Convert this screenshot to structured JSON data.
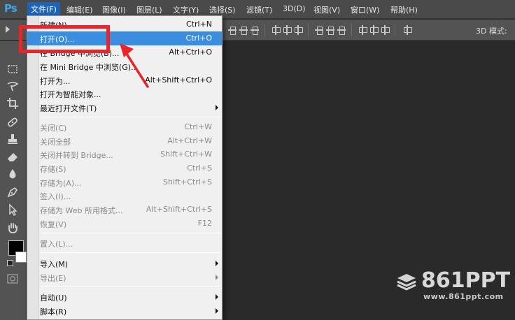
{
  "app": {
    "logo": "Ps"
  },
  "menubar": {
    "items": [
      {
        "label": "文件(F)",
        "active": true
      },
      {
        "label": "编辑(E)"
      },
      {
        "label": "图像(I)"
      },
      {
        "label": "图层(L)"
      },
      {
        "label": "文字(Y)"
      },
      {
        "label": "选择(S)"
      },
      {
        "label": "滤镜(T)"
      },
      {
        "label": "3D(D)"
      },
      {
        "label": "视图(V)"
      },
      {
        "label": "窗口(W)"
      },
      {
        "label": "帮助(H)"
      }
    ]
  },
  "options_bar": {
    "mode_3d_label": "3D 模式:"
  },
  "file_menu": {
    "items": [
      {
        "label": "新建(N)...",
        "shortcut": "Ctrl+N"
      },
      {
        "label": "打开(O)...",
        "shortcut": "Ctrl+O",
        "highlighted": true
      },
      {
        "label": "在 Bridge 中浏览(B)...",
        "shortcut": "Alt+Ctrl+O"
      },
      {
        "label": "在 Mini Bridge 中浏览(G)..."
      },
      {
        "label": "打开为...",
        "shortcut": "Alt+Shift+Ctrl+O"
      },
      {
        "label": "打开为智能对象..."
      },
      {
        "label": "最近打开文件(T)",
        "submenu": true
      },
      {
        "label": "关闭(C)",
        "shortcut": "Ctrl+W",
        "disabled": true
      },
      {
        "label": "关闭全部",
        "shortcut": "Alt+Ctrl+W",
        "disabled": true
      },
      {
        "label": "关闭并转到 Bridge...",
        "shortcut": "Shift+Ctrl+W",
        "disabled": true
      },
      {
        "label": "存储(S)",
        "shortcut": "Ctrl+S",
        "disabled": true
      },
      {
        "label": "存储为(A)...",
        "shortcut": "Shift+Ctrl+S",
        "disabled": true
      },
      {
        "label": "签入(I)...",
        "disabled": true
      },
      {
        "label": "存储为 Web 所用格式...",
        "shortcut": "Alt+Shift+Ctrl+S",
        "disabled": true
      },
      {
        "label": "恢复(V)",
        "shortcut": "F12",
        "disabled": true
      },
      {
        "label": "置入(L)...",
        "disabled": true
      },
      {
        "label": "导入(M)",
        "submenu": true
      },
      {
        "label": "导出(E)",
        "submenu": true,
        "disabled": true
      },
      {
        "label": "自动(U)",
        "submenu": true
      },
      {
        "label": "脚本(R)",
        "submenu": true
      }
    ]
  },
  "tools": {
    "icons": [
      "marquee-icon",
      "lasso-icon",
      "crop-icon",
      "healing-brush-icon",
      "stamp-icon",
      "eraser-icon",
      "blur-icon",
      "pen-icon",
      "selection-arrow-icon",
      "hand-icon",
      "quick-mask-icon"
    ],
    "foreground_color": "#000000",
    "background_color": "#ffffff"
  },
  "annotation": {
    "color": "#e8262a"
  },
  "watermark": {
    "brand": "861PPT",
    "url": "www.861ppt.com"
  }
}
